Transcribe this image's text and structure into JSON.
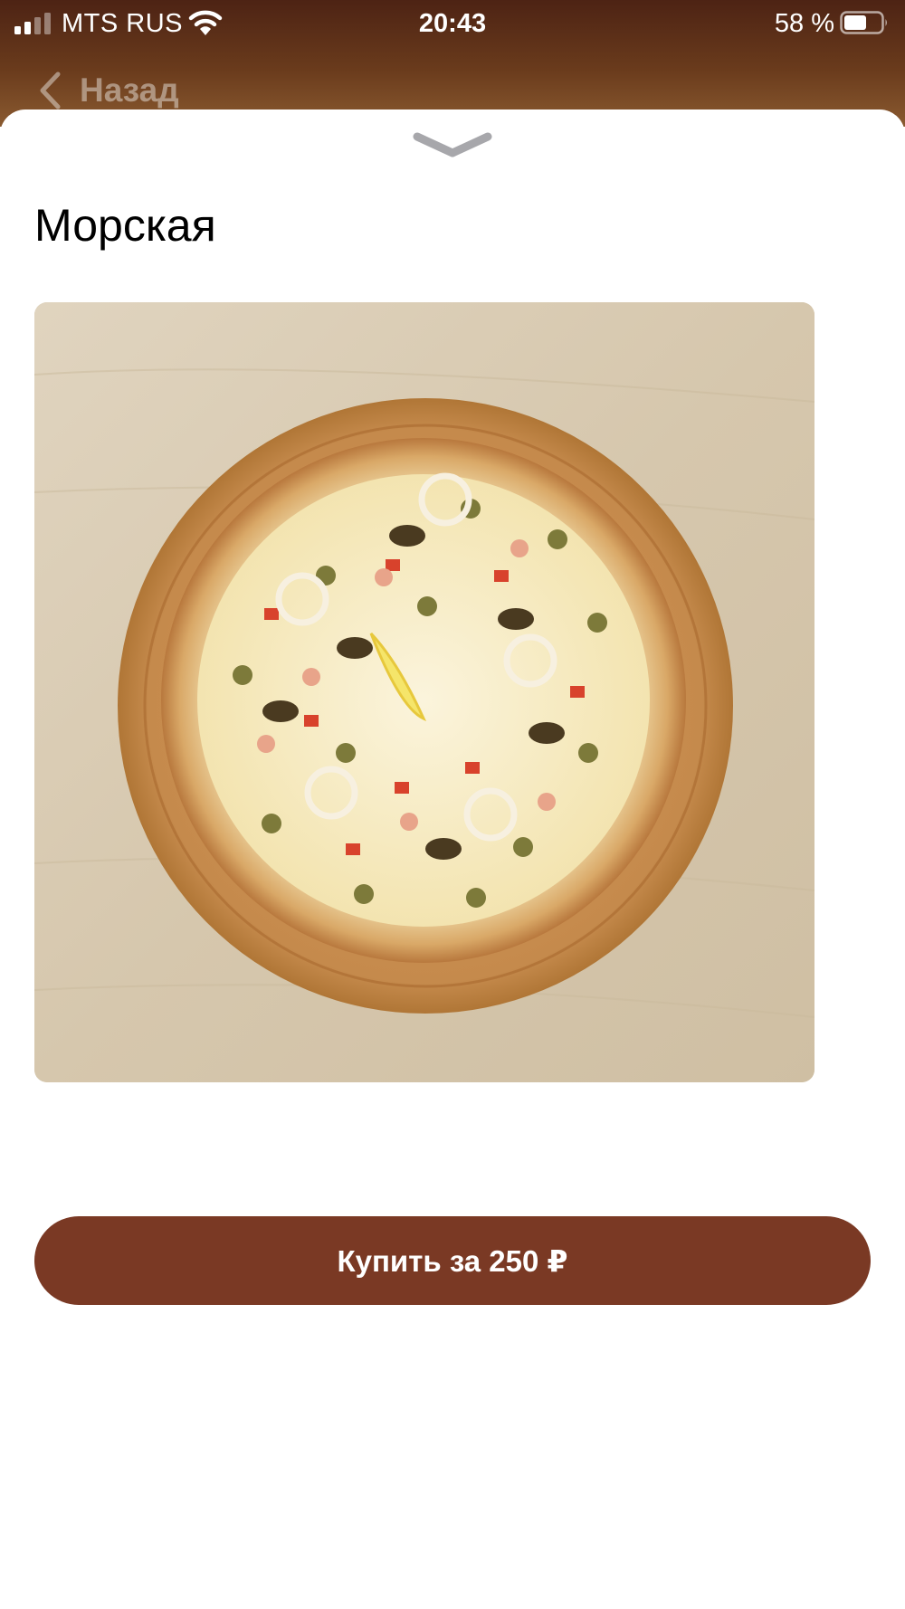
{
  "status_bar": {
    "carrier": "MTS RUS",
    "time": "20:43",
    "battery_percent": "58 %",
    "battery_level": 0.58,
    "signal_bars_filled": 2,
    "icons": [
      "signal-icon",
      "wifi-icon",
      "battery-icon"
    ]
  },
  "nav": {
    "back_label": "Назад",
    "back_icon": "chevron-left-icon"
  },
  "sheet": {
    "grabber_icon": "chevron-down-icon"
  },
  "product": {
    "title": "Морская",
    "image_alt": "pizza-photo"
  },
  "buy_button": {
    "label": "Купить за 250 ₽"
  },
  "colors": {
    "header_brown": "#5a2c18",
    "button_brown": "#7a3924",
    "sheet_background": "#ffffff",
    "text_primary": "#000000"
  }
}
